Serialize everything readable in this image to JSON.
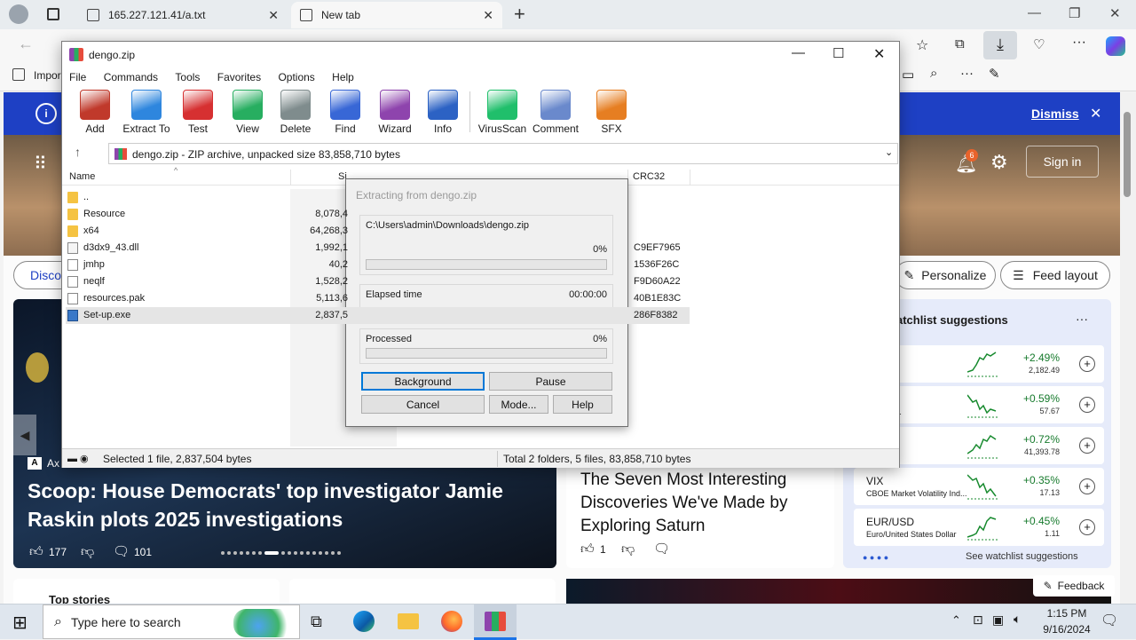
{
  "browser": {
    "tabs": [
      {
        "title": "165.227.121.41/a.txt"
      },
      {
        "title": "New tab"
      }
    ],
    "new_tab_glyph": "+",
    "fav_item": "Impor"
  },
  "msn": {
    "dismiss": "Dismiss",
    "sign_in": "Sign in",
    "notification_count": "6",
    "discover": "Discov",
    "personalize": "Personalize",
    "feed_layout": "Feed layout",
    "lead_story": {
      "source": "Ax",
      "title": "Scoop: House Democrats' top investigator Jamie Raskin plots 2025 investigations",
      "likes": "177",
      "comments": "101"
    },
    "story2": {
      "title": "The Seven Most Interesting Discoveries We've Made by Exploring Saturn",
      "likes": "1"
    },
    "watchlist": {
      "title": "atchlist suggestions",
      "more": "···",
      "items": [
        {
          "name": "",
          "sub": "000",
          "pct": "+2.49%",
          "val": "2,182.49"
        },
        {
          "name": "",
          "sub": "OUP INC.",
          "pct": "+0.59%",
          "val": "57.67"
        },
        {
          "name": "",
          "sub": "",
          "pct": "+0.72%",
          "val": "41,393.78"
        },
        {
          "name": "VIX",
          "sub": "CBOE Market Volatility Ind...",
          "pct": "+0.35%",
          "val": "17.13"
        },
        {
          "name": "EUR/USD",
          "sub": "Euro/United States Dollar",
          "pct": "+0.45%",
          "val": "1.11"
        }
      ],
      "see_more": "See watchlist suggestions"
    },
    "top_stories": "Top stories",
    "feedback": "Feedback"
  },
  "winrar": {
    "title": "dengo.zip",
    "menu": [
      "File",
      "Commands",
      "Tools",
      "Favorites",
      "Options",
      "Help"
    ],
    "tools": [
      {
        "label": "Add",
        "icon": "add-archive-icon",
        "color": "#c0392b"
      },
      {
        "label": "Extract To",
        "icon": "extract-folder-icon",
        "color": "#2e86de"
      },
      {
        "label": "Test",
        "icon": "test-checklist-icon",
        "color": "#d63031"
      },
      {
        "label": "View",
        "icon": "view-book-icon",
        "color": "#27ae60"
      },
      {
        "label": "Delete",
        "icon": "trash-icon",
        "color": "#7f8c8d"
      },
      {
        "label": "Find",
        "icon": "magnifier-icon",
        "color": "#3867d6"
      },
      {
        "label": "Wizard",
        "icon": "magic-wand-icon",
        "color": "#8e44ad"
      },
      {
        "label": "Info",
        "icon": "info-icon",
        "color": "#2c62c4"
      },
      {
        "label": "VirusScan",
        "icon": "bug-scan-icon",
        "color": "#20bf6b"
      },
      {
        "label": "Comment",
        "icon": "comment-icon",
        "color": "#6a89cc"
      },
      {
        "label": "SFX",
        "icon": "sfx-box-icon",
        "color": "#e67e22"
      }
    ],
    "path": "dengo.zip - ZIP archive, unpacked size 83,858,710 bytes",
    "columns": {
      "name": "Name",
      "size": "Si",
      "crc": "CRC32"
    },
    "files": [
      {
        "name": "..",
        "size": "",
        "crc": "",
        "type": "folder"
      },
      {
        "name": "Resource",
        "size": "8,078,4",
        "crc": "",
        "type": "folder"
      },
      {
        "name": "x64",
        "size": "64,268,3",
        "crc": "",
        "type": "folder"
      },
      {
        "name": "d3dx9_43.dll",
        "size": "1,992,1",
        "crc": "C9EF7965",
        "type": "dll"
      },
      {
        "name": "jmhp",
        "size": "40,2",
        "crc": "1536F26C",
        "type": "file"
      },
      {
        "name": "neqlf",
        "size": "1,528,2",
        "crc": "F9D60A22",
        "type": "file"
      },
      {
        "name": "resources.pak",
        "size": "5,113,6",
        "crc": "40B1E83C",
        "type": "file"
      },
      {
        "name": "Set-up.exe",
        "size": "2,837,5",
        "crc": "286F8382",
        "type": "exe"
      }
    ],
    "status_left": "Selected 1 file, 2,837,504 bytes",
    "status_right": "Total 2 folders, 5 files, 83,858,710 bytes"
  },
  "extract_dialog": {
    "title": "Extracting from dengo.zip",
    "path": "C:\\Users\\admin\\Downloads\\dengo.zip",
    "file_pct": "0%",
    "file_progress": 0,
    "elapsed_label": "Elapsed time",
    "elapsed_value": "00:00:00",
    "processed_label": "Processed",
    "processed_pct": "0%",
    "processed_progress": 0,
    "buttons": {
      "background": "Background",
      "pause": "Pause",
      "cancel": "Cancel",
      "mode": "Mode...",
      "help": "Help"
    }
  },
  "taskbar": {
    "search_placeholder": "Type here to search",
    "time": "1:15 PM",
    "date": "9/16/2024"
  }
}
